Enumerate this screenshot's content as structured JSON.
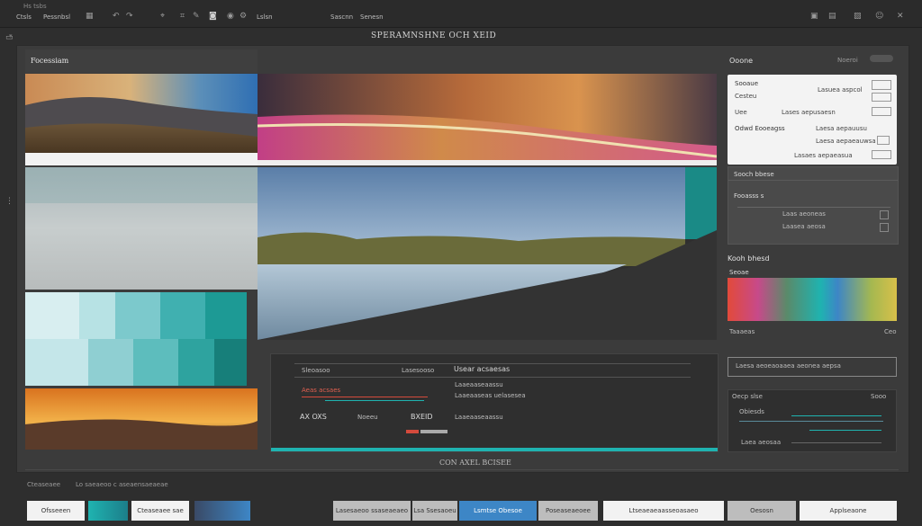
{
  "menubar": {
    "app_label": "Hs tsbs",
    "items": [
      "Ctsls",
      "Pessnbsl",
      "Lslsn",
      "Sascnn",
      "Senesn"
    ]
  },
  "window": {
    "title": "SPERAMNSHNE OCH XEID"
  },
  "left_panel": {
    "title": "Focessiam"
  },
  "right_panel": {
    "header": "Ooone",
    "header_btn": "Noeroi",
    "card1": {
      "title": "Sooaue",
      "row1_label": "Cesteu",
      "row1_value": "Lasuea aspcol",
      "row2_label": "Uee",
      "row2_value": "Lases aepusaesn",
      "section2": "Odwd Eooeagss",
      "row3_value": "Laesa aepauusu",
      "row4_value": "Laesa aepaeauwsa",
      "row5_value": "Lasaes aepaeasua"
    },
    "card2": {
      "title": "Sooch bbese",
      "label": "Fooasss s",
      "row1": "Laas aeoneas",
      "row2": "Laasea aeosa"
    },
    "gradient_title": "Kooh bhesd",
    "gradient_label": "Seoae",
    "gradient_caption": "Taaaeas",
    "gradient_value": "Ceo",
    "search_field": "Laesa aeoeaoaaea aeonea aepsa",
    "chart_title": "Oecp slse",
    "chart_value": "Sooo",
    "chart_label": "Obiesds",
    "chart_legend": "Laea aeosaa"
  },
  "image_strip": {
    "thumbnails": [
      "Mountain sunset",
      "Grey overcast",
      "Teal mosaic",
      "Orange horizon"
    ]
  },
  "main_canvas": {
    "bottom_panel": {
      "header_left": "Sleoasoo",
      "header_mid": "Lasesooso",
      "header_right": "Usear acsaesas",
      "red_label": "Aeas acsaes",
      "row_a": "Laaeaaseaassu",
      "row_b": "Laaeaaseas uelasesea",
      "stat1": "AX OXS",
      "stat2": "Noeeu",
      "stat3": "BXEID"
    },
    "footer_label": "CON AXEL BCISEE"
  },
  "status": {
    "label": "Cteaseaee",
    "sublabel": "Lo saeaeoo c aseaensaeaeae"
  },
  "bottom_bar": {
    "buttons": [
      "Ofsseeen",
      "Cteaseaee sae",
      "Lasesaeoo ssaseaeaeo",
      "Lsa Ssesaoeu",
      "Lsmtse Obesoe",
      "Poseaseaeoee",
      "Ltseaeaeaasseoasaeo",
      "Oesosn",
      "Applseaone"
    ]
  },
  "colors": {
    "background": "#2e2e2e",
    "panel": "#3a3a3a",
    "accent_teal": "#1fb3b0",
    "accent_blue": "#3d86c6",
    "accent_red": "#d44a3c"
  }
}
